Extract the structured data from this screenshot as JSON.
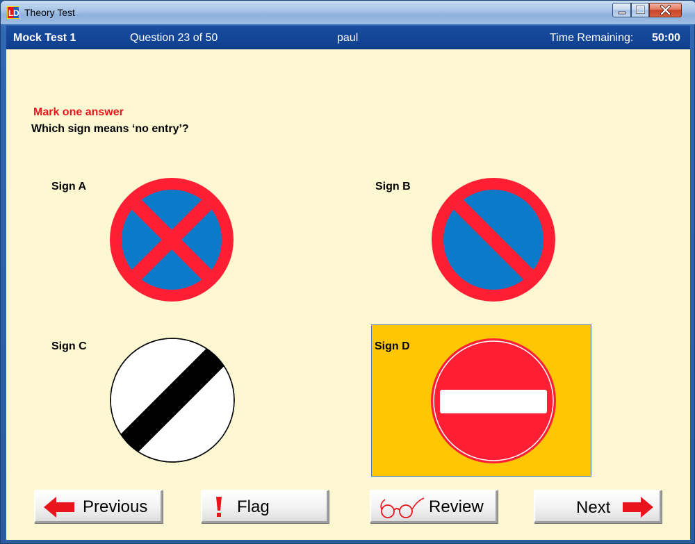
{
  "window": {
    "title": "Theory Test"
  },
  "header": {
    "test_name": "Mock Test 1",
    "question_counter": "Question 23 of 50",
    "user": "paul",
    "time_label": "Time Remaining:",
    "time_value": "50:00"
  },
  "question": {
    "instruction": "Mark one answer",
    "text": "Which sign means ‘no entry’?"
  },
  "options": [
    {
      "label": "Sign A",
      "icon": "no-stopping-sign-icon",
      "selected": false
    },
    {
      "label": "Sign B",
      "icon": "no-waiting-sign-icon",
      "selected": false
    },
    {
      "label": "Sign C",
      "icon": "national-speed-limit-sign-icon",
      "selected": false
    },
    {
      "label": "Sign D",
      "icon": "no-entry-sign-icon",
      "selected": true
    }
  ],
  "nav": {
    "previous_label": "Previous",
    "flag_label": "Flag",
    "review_label": "Review",
    "next_label": "Next"
  },
  "colors": {
    "header_bg": "#0f3f8f",
    "content_bg": "#fef8d2",
    "selected_bg": "#fec701",
    "instruction_red": "#e8151d",
    "sign_red": "#ff1f35",
    "sign_blue": "#0b7ac9"
  }
}
